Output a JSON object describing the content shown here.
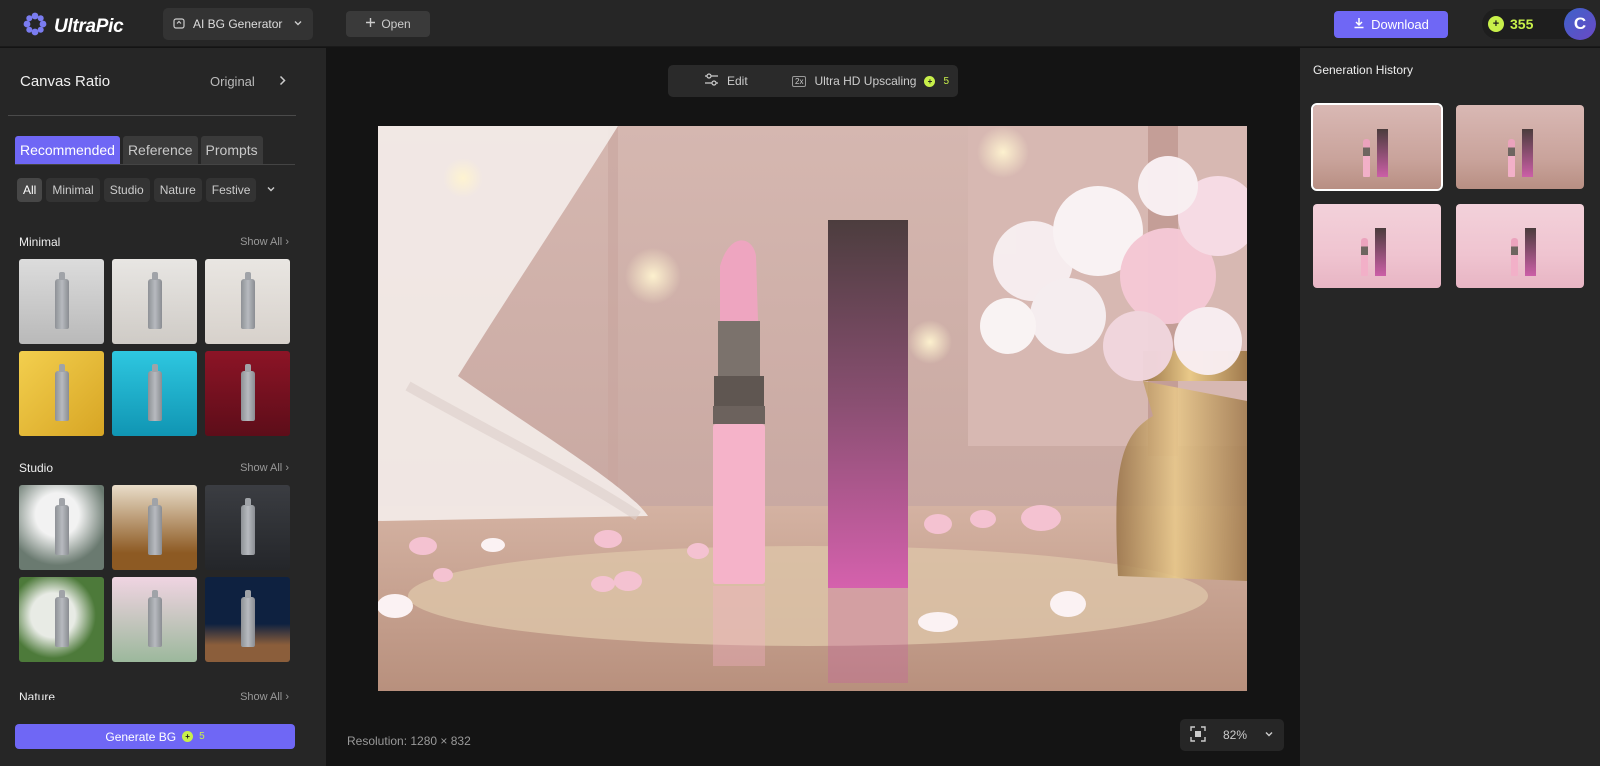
{
  "app": {
    "name": "UltraPic",
    "tool": "AI BG Generator",
    "open_label": "Open",
    "download_label": "Download",
    "credits": "355",
    "avatar_letter": "C"
  },
  "left_panel": {
    "canvas_ratio_label": "Canvas Ratio",
    "canvas_ratio_value": "Original",
    "tabs": [
      "Recommended",
      "Reference",
      "Prompts"
    ],
    "active_tab": "Recommended",
    "chips": [
      "All",
      "Minimal",
      "Studio",
      "Nature",
      "Festive"
    ],
    "active_chip": "All",
    "sections": [
      {
        "title": "Minimal",
        "show_all": "Show All"
      },
      {
        "title": "Studio",
        "show_all": "Show All"
      },
      {
        "title": "Nature",
        "show_all": "Show All"
      }
    ],
    "generate_label": "Generate BG",
    "generate_cost": "5"
  },
  "center": {
    "edit_label": "Edit",
    "upscale_badge": "2x",
    "upscale_label": "Ultra HD Upscaling",
    "upscale_cost": "5",
    "resolution": "Resolution: 1280 × 832",
    "zoom": "82%"
  },
  "right_panel": {
    "title": "Generation History"
  },
  "colors": {
    "accent": "#6f67f5",
    "credit": "#c8f04a",
    "panel": "#262626",
    "background": "#141414"
  },
  "icons": [
    "logo-icon",
    "generator-icon",
    "chevron-down-icon",
    "plus-icon",
    "download-icon",
    "credit-icon",
    "chevron-right-icon",
    "sliders-icon",
    "fit-screen-icon"
  ]
}
